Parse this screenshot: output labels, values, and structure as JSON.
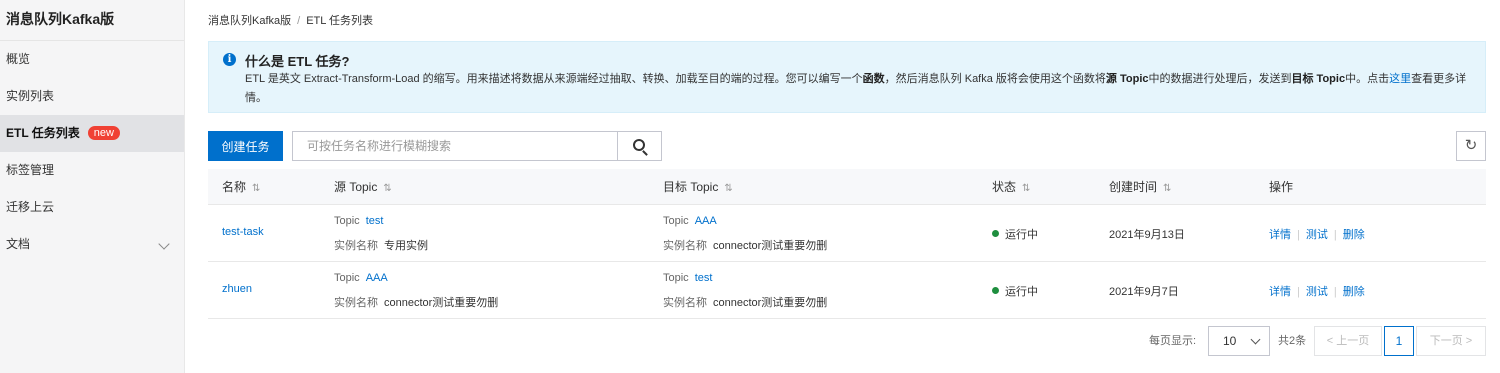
{
  "sidebar": {
    "title": "消息队列Kafka版",
    "items": [
      {
        "label": "概览"
      },
      {
        "label": "实例列表"
      },
      {
        "label": "ETL 任务列表",
        "badge": "new"
      },
      {
        "label": "标签管理"
      },
      {
        "label": "迁移上云"
      },
      {
        "label": "文档"
      }
    ]
  },
  "breadcrumb": {
    "root": "消息队列Kafka版",
    "separator": "/",
    "current": "ETL 任务列表"
  },
  "notice": {
    "icon": "info-icon",
    "title": "什么是 ETL 任务?",
    "body_1": "ETL 是英文 Extract-Transform-Load 的缩写。用来描述将数据从来源端经过抽取、转换、加载至目的端的过程。您可以编写一个",
    "bold_1": "函数",
    "body_2": "，然后消息队列 Kafka 版将会使用这个函数将",
    "bold_2": "源 Topic",
    "body_3": "中的数据进行处理后，发送到",
    "bold_3": "目标 Topic",
    "body_4": "中。点击",
    "link": "这里",
    "body_5": "查看更多详情。"
  },
  "toolbar": {
    "create_label": "创建任务",
    "search_placeholder": "可按任务名称进行模糊搜索",
    "search_icon": "search-icon",
    "refresh_icon": "refresh-icon"
  },
  "table": {
    "columns": [
      "名称",
      "源 Topic",
      "目标 Topic",
      "状态",
      "创建时间",
      "操作"
    ],
    "rows": [
      {
        "name": "test-task",
        "src_topic_label": "Topic",
        "src_topic": "test",
        "src_inst_label": "实例名称",
        "src_inst": "专用实例",
        "dst_topic_label": "Topic",
        "dst_topic": "AAA",
        "dst_inst_label": "实例名称",
        "dst_inst": "connector测试重要勿删",
        "status": "运行中",
        "created": "2021年9月13日",
        "op_detail": "详情",
        "op_test": "测试",
        "op_delete": "删除"
      },
      {
        "name": "zhuen",
        "src_topic_label": "Topic",
        "src_topic": "AAA",
        "src_inst_label": "实例名称",
        "src_inst": "connector测试重要勿删",
        "dst_topic_label": "Topic",
        "dst_topic": "test",
        "dst_inst_label": "实例名称",
        "dst_inst": "connector测试重要勿删",
        "status": "运行中",
        "created": "2021年9月7日",
        "op_detail": "详情",
        "op_test": "测试",
        "op_delete": "删除"
      }
    ]
  },
  "pagination": {
    "page_size_label": "每页显示:",
    "page_size": "10",
    "total": "共2条",
    "prev": "< 上一页",
    "current": "1",
    "next": "下一页 >"
  },
  "colors": {
    "primary": "#0070cc",
    "running": "#1e8e3e",
    "badge": "#f04134",
    "notice_bg": "#e6f5fc"
  }
}
